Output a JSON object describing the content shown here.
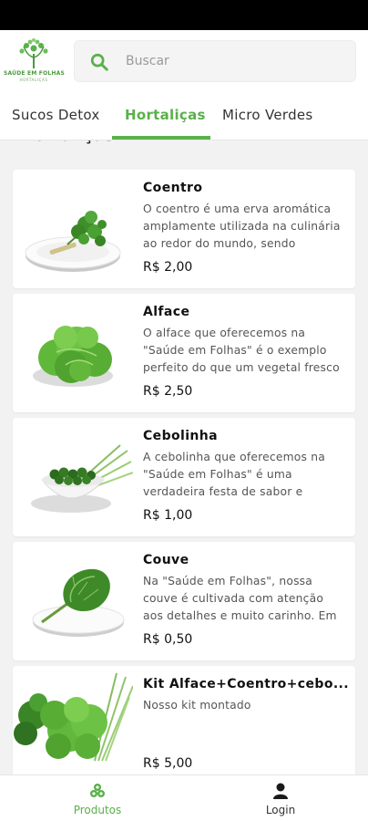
{
  "brand": {
    "name": "SAÚDE EM FOLHAS",
    "tagline": "HORTALIÇAS",
    "accent_color": "#5ab04a"
  },
  "search": {
    "placeholder": "Buscar",
    "icon": "search-icon"
  },
  "tabs": [
    {
      "label": "Sucos Detox",
      "active": false
    },
    {
      "label": "Hortaliças",
      "active": true
    },
    {
      "label": "Micro Verdes",
      "active": false
    }
  ],
  "section_heading": "Hortaliças",
  "products": [
    {
      "name": "Coentro",
      "description": "O coentro é uma erva aromática amplamente utilizada na culinária ao redor do mundo, sendo",
      "price": "R$ 2,00",
      "image": "coriander-on-plate"
    },
    {
      "name": "Alface",
      "description": "O alface que oferecemos na \"Saúde em Folhas\" é o exemplo perfeito do que um vegetal fresco",
      "price": "R$ 2,50",
      "image": "lettuce-on-plate"
    },
    {
      "name": "Cebolinha",
      "description": "A cebolinha que oferecemos na \"Saúde em Folhas\" é uma verdadeira festa de sabor e frescor",
      "price": "R$ 1,00",
      "image": "chives-in-bowl"
    },
    {
      "name": "Couve",
      "description": "Na \"Saúde em Folhas\", nossa couve é cultivada com atenção aos detalhes e muito carinho. Em",
      "price": "R$ 0,50",
      "image": "kale-on-plate"
    },
    {
      "name": "Kit Alface+Coentro+cebo...",
      "description": "Nosso kit montado",
      "price": "R$ 5,00",
      "image": "vegetable-kit"
    }
  ],
  "bottom_nav": [
    {
      "label": "Produtos",
      "icon": "products-icon",
      "active": true
    },
    {
      "label": "Login",
      "icon": "user-icon",
      "active": false
    }
  ]
}
